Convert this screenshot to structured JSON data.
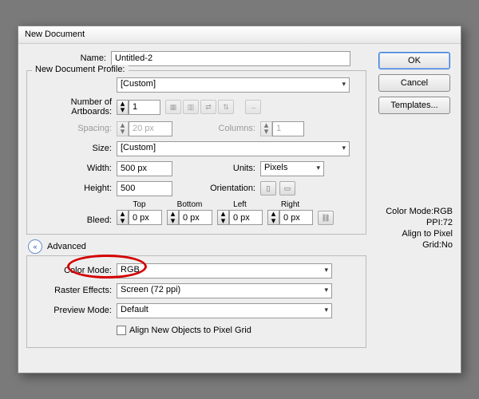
{
  "title": "New Document",
  "buttons": {
    "ok": "OK",
    "cancel": "Cancel",
    "templates": "Templates..."
  },
  "info": {
    "l1": "Color Mode:RGB",
    "l2": "PPI:72",
    "l3": "Align to Pixel Grid:No"
  },
  "name_lbl": "Name:",
  "name_val": "Untitled-2",
  "profile_lbl": "New Document Profile:",
  "profile_val": "[Custom]",
  "artboards_lbl": "Number of Artboards:",
  "artboards_val": "1",
  "spacing_lbl": "Spacing:",
  "spacing_val": "20 px",
  "columns_lbl": "Columns:",
  "columns_val": "1",
  "size_lbl": "Size:",
  "size_val": "[Custom]",
  "width_lbl": "Width:",
  "width_val": "500 px",
  "units_lbl": "Units:",
  "units_val": "Pixels",
  "height_lbl": "Height:",
  "height_val": "500",
  "orient_lbl": "Orientation:",
  "bleed_lbl": "Bleed:",
  "bleed_val": "0 px",
  "bleed_cols": {
    "top": "Top",
    "bottom": "Bottom",
    "left": "Left",
    "right": "Right"
  },
  "advanced_lbl": "Advanced",
  "color_lbl": "Color Mode:",
  "color_val": "RGB",
  "raster_lbl": "Raster Effects:",
  "raster_val": "Screen (72 ppi)",
  "preview_lbl": "Preview Mode:",
  "preview_val": "Default",
  "align_lbl": "Align New Objects to Pixel Grid"
}
